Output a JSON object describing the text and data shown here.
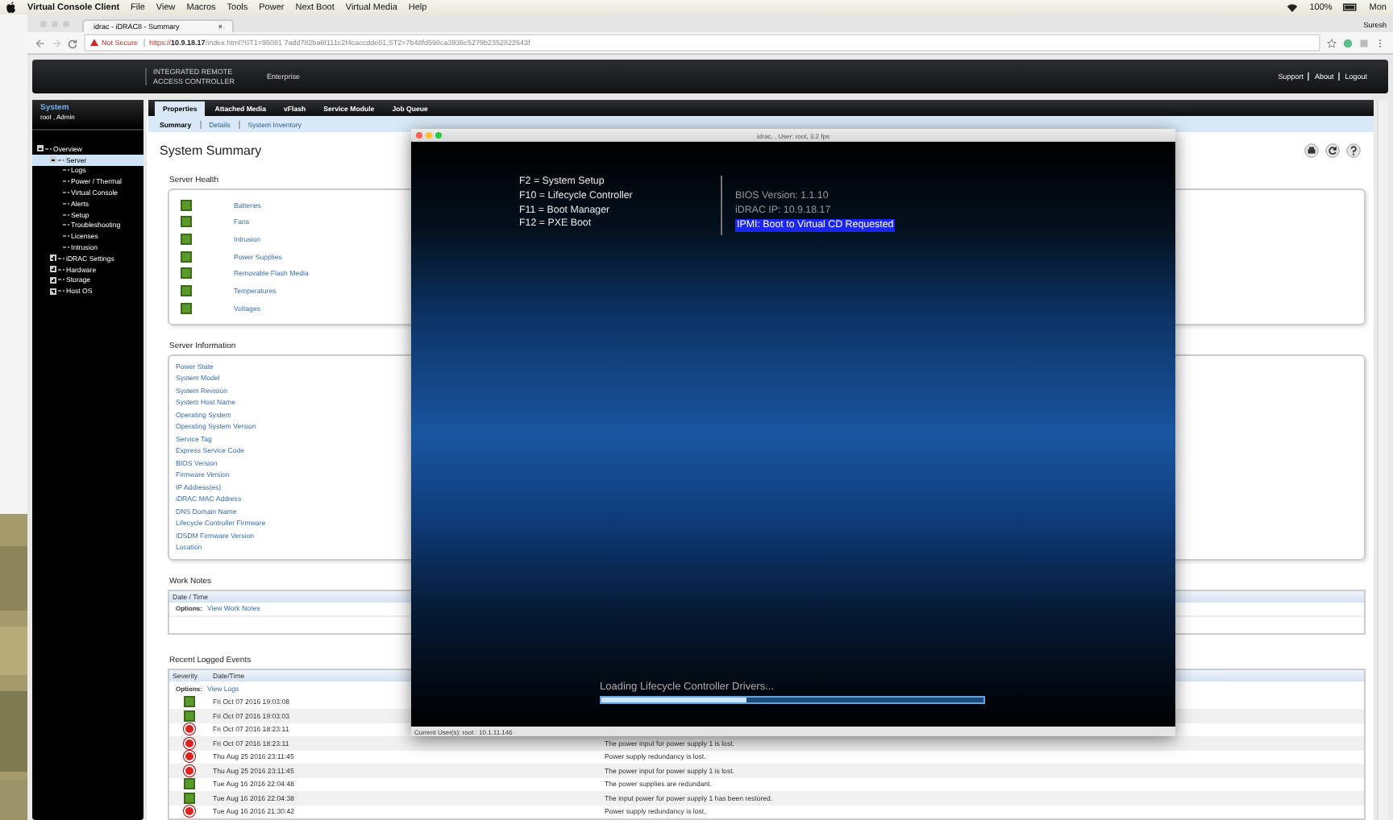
{
  "menubar": {
    "app": "Virtual Console Client",
    "menus": [
      "File",
      "View",
      "Macros",
      "Tools",
      "Power",
      "Next Boot",
      "Virtual Media",
      "Help"
    ],
    "battery": "100%",
    "clock": "Mon"
  },
  "browser": {
    "tab": "idrac - iDRAC8 - Summary",
    "tab_close": "×",
    "profile": "Suresh",
    "security": "Not Secure",
    "url_scheme": "https://",
    "url_host": "10.9.18.17",
    "url_path": "/index.html?ST1=95081 7add782ba6f111c2f4caccdde81,ST2=7b48fd598ca3936c5279b2352822643f"
  },
  "header": {
    "title_line1": "INTEGRATED REMOTE",
    "title_line2": "ACCESS CONTROLLER",
    "edition": "Enterprise",
    "links": [
      "Support",
      "About",
      "Logout"
    ]
  },
  "sidebar": {
    "title": "System",
    "user": "root , Admin",
    "tree": [
      {
        "label": "Overview",
        "expanded": true,
        "selected": false,
        "children": [
          {
            "label": "Server",
            "expanded": true,
            "selected": true,
            "children": [
              {
                "label": "Logs",
                "selected": false
              },
              {
                "label": "Power / Thermal",
                "selected": false
              },
              {
                "label": "Virtual Console",
                "selected": false
              },
              {
                "label": "Alerts",
                "selected": false
              },
              {
                "label": "Setup",
                "selected": false
              },
              {
                "label": "Troubleshooting",
                "selected": false
              },
              {
                "label": "Licenses",
                "selected": false
              },
              {
                "label": "Intrusion",
                "selected": false
              }
            ]
          },
          {
            "label": "iDRAC Settings",
            "expanded": false,
            "selected": false
          },
          {
            "label": "Hardware",
            "expanded": false,
            "selected": false
          },
          {
            "label": "Storage",
            "expanded": false,
            "selected": false
          },
          {
            "label": "Host OS",
            "expanded": false,
            "selected": false
          }
        ]
      }
    ]
  },
  "tabs": [
    {
      "label": "Properties",
      "selected": true
    },
    {
      "label": "Attached Media",
      "selected": false
    },
    {
      "label": "vFlash",
      "selected": false
    },
    {
      "label": "Service Module",
      "selected": false
    },
    {
      "label": "Job Queue",
      "selected": false
    }
  ],
  "subtabs": [
    {
      "label": "Summary",
      "selected": true
    },
    {
      "label": "Details",
      "selected": false
    },
    {
      "label": "System Inventory",
      "selected": false
    }
  ],
  "page_title": "System Summary",
  "server_health": {
    "title": "Server Health",
    "items": [
      {
        "label": "Batteries",
        "kind": "ok"
      },
      {
        "label": "Fans",
        "kind": "ok"
      },
      {
        "label": "Intrusion",
        "kind": "ok"
      },
      {
        "label": "Power Supplies",
        "kind": "ok"
      },
      {
        "label": "Removable Flash Media",
        "kind": "ok"
      },
      {
        "label": "Temperatures",
        "kind": "ok"
      },
      {
        "label": "Voltages",
        "kind": "ok"
      }
    ]
  },
  "server_information": {
    "title": "Server Information",
    "items": [
      "Power State",
      "System Model",
      "System Revision",
      "System Host Name",
      "Operating System",
      "Operating System Version",
      "Service Tag",
      "Express Service Code",
      "BIOS Version",
      "Firmware Version",
      "IP Address(es)",
      "iDRAC MAC Address",
      "DNS Domain Name",
      "Lifecycle Controller Firmware",
      "IDSDM Firmware Version",
      "Location"
    ]
  },
  "work_notes": {
    "title": "Work Notes",
    "column": "Date / Time",
    "options_label": "Options:",
    "options_link": "View Work Notes"
  },
  "events": {
    "title": "Recent Logged Events",
    "columns": [
      "Severity",
      "Date/Time"
    ],
    "options_label": "Options:",
    "options_link": "View Logs",
    "rows": [
      {
        "kind": "ok",
        "time": "Fri Oct 07 2016 19:03:08"
      },
      {
        "kind": "ok",
        "time": "Fri Oct 07 2016 19:03:03"
      },
      {
        "kind": "critical",
        "time": "Fri Oct 07 2016 18:23:11"
      },
      {
        "kind": "critical",
        "time": "Fri Oct 07 2016 18:23:11",
        "message": "The power input for power supply 1 is lost."
      },
      {
        "kind": "critical",
        "time": "Thu Aug 25 2016 23:11:45",
        "message": "Power supply redundancy is lost."
      },
      {
        "kind": "critical",
        "time": "Thu Aug 25 2016 23:11:45",
        "message": "The power input for power supply 1 is lost."
      },
      {
        "kind": "ok",
        "time": "Tue Aug 16 2016 22:04:48",
        "message": "The power supplies are redundant."
      },
      {
        "kind": "ok",
        "time": "Tue Aug 16 2016 22:04:38",
        "message": "The input power for power supply 1 has been restored."
      },
      {
        "kind": "critical",
        "time": "Tue Aug 16 2016 21:30:42",
        "message": "Power supply redundancy is lost."
      }
    ]
  },
  "console": {
    "title": "idrac, , User: root, 3.2 fps",
    "boot_keys": [
      "F2  = System Setup",
      "F10 = Lifecycle Controller",
      "F11 = Boot Manager",
      "F12 = PXE Boot"
    ],
    "info": [
      {
        "text": "BIOS Version: 1.1.10",
        "highlighted": false
      },
      {
        "text": "iDRAC IP:  10.9.18.17",
        "highlighted": false
      },
      {
        "text": "IPMI: Boot to Virtual CD Requested",
        "highlighted": true
      }
    ],
    "loading": "Loading Lifecycle Controller Drivers...",
    "progress": {
      "level": 0.38
    },
    "status": "Current User(s): root : 10.1.11.146"
  }
}
